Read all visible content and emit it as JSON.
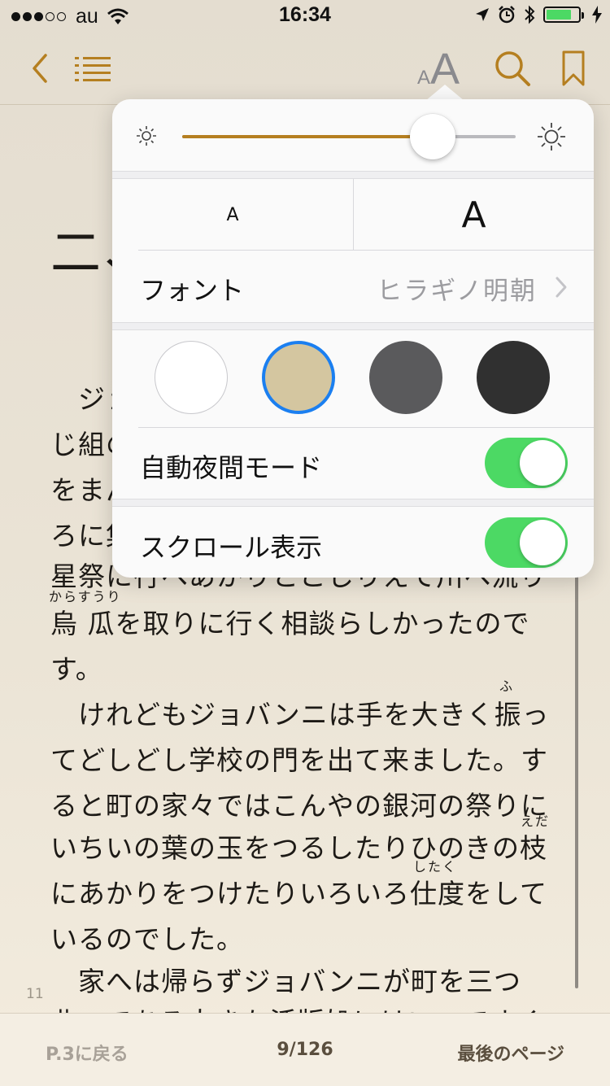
{
  "status_bar": {
    "carrier": "au",
    "time": "16:34",
    "signal_total": 5,
    "signal_filled": 3,
    "battery_level": 0.8,
    "battery_color": "#4cd964",
    "icons": [
      "wifi-icon",
      "location-arrow-icon",
      "alarm-icon",
      "bluetooth-icon",
      "battery-icon",
      "charging-bolt-icon"
    ]
  },
  "nav": {
    "accent_color": "#b57f20",
    "font_size_button_small": "A",
    "font_size_button_large": "A",
    "icons": [
      "back-chevron-icon",
      "table-of-contents-icon",
      "font-size-icon",
      "search-icon",
      "bookmark-icon"
    ]
  },
  "reader": {
    "chapter_title": "二、",
    "lines": [
      "ジョ",
      "じ組の",
      "をまん",
      "ろに集",
      "星祭に行へあかりとこしりえて川へ流り",
      "烏 瓜を取りに行く相談らしかったので",
      "す。",
      "けれどもジョバンニは手を大きく振っ",
      "てどしどし学校の門を出て来ました。す",
      "ると町の家々ではこんやの銀河の祭りに",
      "いちいの葉の玉をつるしたりひのきの枝",
      "にあかりをつけたりいろいろ仕度をして",
      "いるのでした。",
      "家へは帰らずジョバンニが町を三つ",
      "曲ってある大きな活版処にはいってすぐ"
    ],
    "ruby": {
      "karasuuri": "からすうり",
      "fu": "ふ",
      "eda": "えだ",
      "shitaku": "したく"
    },
    "page_number": "11"
  },
  "bottom_bar": {
    "back_label": "P.3に戻る",
    "page_count": "9/126",
    "last_page_label": "最後のページ"
  },
  "settings_popover": {
    "brightness": 0.75,
    "font_size_small_label": "A",
    "font_size_large_label": "A",
    "font_label": "フォント",
    "font_value": "ヒラギノ明朝",
    "themes": [
      {
        "name": "white",
        "color": "#ffffff",
        "selected": false
      },
      {
        "name": "sepia",
        "color": "#d4c6a0",
        "selected": true
      },
      {
        "name": "gray",
        "color": "#5a5a5c",
        "selected": false
      },
      {
        "name": "night",
        "color": "#303030",
        "selected": false
      }
    ],
    "selected_border_color": "#1b7ff0",
    "auto_night_label": "自動夜間モード",
    "auto_night_on": true,
    "scroll_label": "スクロール表示",
    "scroll_on": true,
    "toggle_color": "#4cd964"
  }
}
